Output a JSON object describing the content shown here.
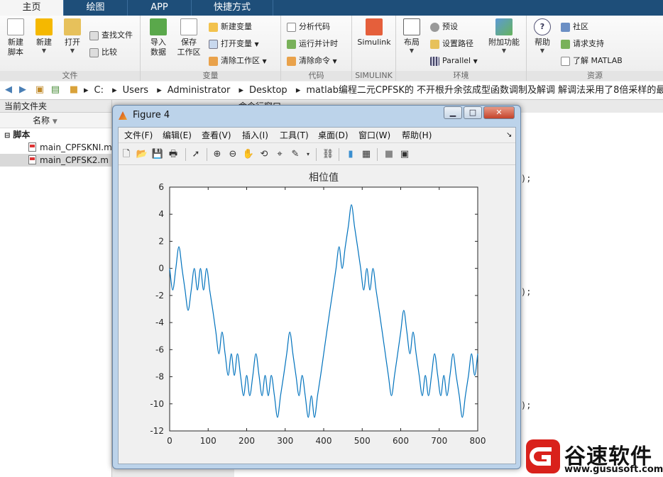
{
  "tabs": [
    "主页",
    "绘图",
    "APP",
    "快捷方式"
  ],
  "ribbon": {
    "file": {
      "title": "文件",
      "new_script": "新建\n脚本",
      "new": "新建",
      "open": "打开",
      "find_files": "查找文件",
      "compare": "比较"
    },
    "variable": {
      "title": "变量",
      "import": "导入\n数据",
      "save_ws": "保存\n工作区",
      "new_var": "新建变量",
      "open_var": "打开变量",
      "clear_ws": "清除工作区"
    },
    "code": {
      "title": "代码",
      "analyze": "分析代码",
      "run_time": "运行并计时",
      "clear_cmd": "清除命令"
    },
    "simulink": {
      "title": "SIMULINK",
      "simulink": "Simulink"
    },
    "env": {
      "title": "环境",
      "layout": "布局",
      "prefs": "预设",
      "set_path": "设置路径",
      "parallel": "Parallel",
      "addons": "附加功能"
    },
    "resources": {
      "title": "资源",
      "help": "帮助",
      "community": "社区",
      "support": "请求支持",
      "learn": "了解 MATLAB"
    }
  },
  "address": {
    "crumbs": [
      "C:",
      "Users",
      "Administrator",
      "Desktop",
      "matlab编程二元CPFSK的 不开根升余弦成型函数调制及解调 解调法采用了8倍采样的最终点解调源码附"
    ]
  },
  "left_panel": {
    "title": "当前文件夹",
    "column": "名称",
    "group": "脚本",
    "files": [
      "main_CPFSKNI.m",
      "main_CPFSK2.m"
    ]
  },
  "command_window": {
    "title": "命令行窗口",
    "frag": ");"
  },
  "figure": {
    "title": "Figure 4",
    "menus": [
      "文件(F)",
      "编辑(E)",
      "查看(V)",
      "插入(I)",
      "工具(T)",
      "桌面(D)",
      "窗口(W)",
      "帮助(H)"
    ]
  },
  "chart_data": {
    "type": "line",
    "title": "相位值",
    "xlabel": "",
    "ylabel": "",
    "xlim": [
      0,
      800
    ],
    "ylim": [
      -12,
      6
    ],
    "xticks": [
      0,
      100,
      200,
      300,
      400,
      500,
      600,
      700,
      800
    ],
    "yticks": [
      6,
      4,
      2,
      0,
      -2,
      -4,
      -6,
      -8,
      -10,
      -12
    ],
    "color": "#0072bd",
    "x": [
      0,
      8,
      16,
      24,
      32,
      40,
      48,
      56,
      64,
      72,
      80,
      88,
      96,
      104,
      112,
      120,
      128,
      136,
      144,
      152,
      160,
      168,
      176,
      184,
      192,
      200,
      208,
      216,
      224,
      232,
      240,
      248,
      256,
      264,
      272,
      280,
      288,
      296,
      304,
      312,
      320,
      328,
      336,
      344,
      352,
      360,
      368,
      376,
      384,
      392,
      400,
      408,
      416,
      424,
      432,
      440,
      448,
      456,
      464,
      472,
      480,
      488,
      496,
      504,
      512,
      520,
      528,
      536,
      544,
      552,
      560,
      568,
      576,
      584,
      592,
      600,
      608,
      616,
      624,
      632,
      640,
      648,
      656,
      664,
      672,
      680,
      688,
      696,
      704,
      712,
      720,
      728,
      736,
      744,
      752,
      760,
      768,
      776,
      784,
      792,
      800
    ],
    "y": [
      0,
      -1.6,
      0,
      1.6,
      0,
      -1.6,
      -3.1,
      -1.6,
      0,
      -1.6,
      0,
      -1.6,
      0,
      -1.6,
      -3.1,
      -4.7,
      -6.3,
      -4.7,
      -6.3,
      -7.9,
      -6.3,
      -7.9,
      -6.3,
      -7.9,
      -9.4,
      -7.9,
      -9.4,
      -7.9,
      -6.3,
      -7.9,
      -9.4,
      -7.9,
      -9.4,
      -7.9,
      -9.4,
      -11,
      -9.4,
      -7.9,
      -6.3,
      -4.7,
      -6.3,
      -7.9,
      -9.4,
      -7.9,
      -9.4,
      -11,
      -9.4,
      -11,
      -9.4,
      -7.9,
      -6.3,
      -4.7,
      -3.1,
      -1.6,
      0,
      1.6,
      0,
      1.6,
      3.1,
      4.7,
      3.1,
      1.6,
      0,
      -1.6,
      0,
      -1.6,
      0,
      -1.6,
      -3.1,
      -4.7,
      -6.3,
      -7.9,
      -9.4,
      -7.9,
      -6.3,
      -4.7,
      -3.1,
      -4.7,
      -6.3,
      -4.7,
      -6.3,
      -7.9,
      -9.4,
      -7.9,
      -9.4,
      -7.9,
      -6.3,
      -7.9,
      -9.4,
      -7.9,
      -9.4,
      -7.9,
      -6.3,
      -7.9,
      -9.4,
      -11,
      -9.4,
      -7.9,
      -6.3,
      -7.9,
      -6.3
    ]
  },
  "watermark": {
    "name": "谷速软件",
    "url": "www.gususoft.com"
  }
}
